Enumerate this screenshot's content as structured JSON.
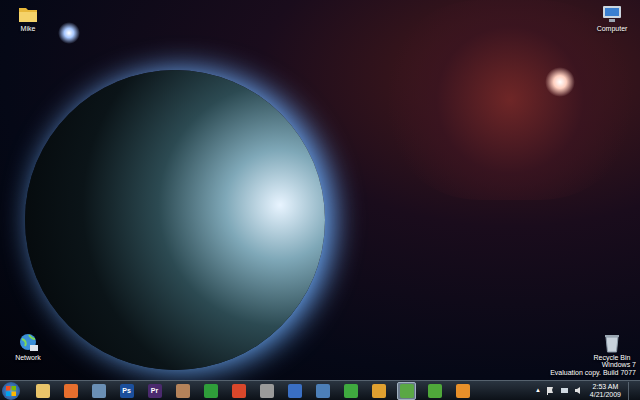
{
  "desktop_icons": [
    {
      "label": "Mike",
      "kind": "folder"
    },
    {
      "label": "Computer",
      "kind": "computer"
    },
    {
      "label": "Network",
      "kind": "network"
    },
    {
      "label": "Recycle Bin",
      "kind": "recycle-bin"
    }
  ],
  "watermark": [
    "Windows 7",
    "Evaluation copy. Build 7077"
  ],
  "taskbar": {
    "start_button": {
      "selected": false
    },
    "items": [
      {
        "label": "",
        "color": "#e9c46a",
        "active": false
      },
      {
        "label": "",
        "color": "#e76f2e",
        "active": false
      },
      {
        "label": "",
        "color": "#6a8fb5",
        "active": false
      },
      {
        "label": "Ps",
        "color": "#1b4f9c",
        "active": false
      },
      {
        "label": "Pr",
        "color": "#4b2a6e",
        "active": false
      },
      {
        "label": "",
        "color": "#b5835a",
        "active": false
      },
      {
        "label": "",
        "color": "#2f9e3a",
        "active": false
      },
      {
        "label": "",
        "color": "#d9472b",
        "active": false
      },
      {
        "label": "",
        "color": "#9a9a9a",
        "active": false
      },
      {
        "label": "",
        "color": "#3a6fc4",
        "active": false
      },
      {
        "label": "",
        "color": "#4c7fb8",
        "active": false
      },
      {
        "label": "",
        "color": "#3faa3f",
        "active": false
      },
      {
        "label": "",
        "color": "#e0a030",
        "active": false
      },
      {
        "label": "",
        "color": "#5aa845",
        "active": true
      },
      {
        "label": "",
        "color": "#4fa83a",
        "active": false
      },
      {
        "label": "",
        "color": "#e8902a",
        "active": false
      }
    ],
    "tray": {
      "overflow": "▲",
      "time": "2:53 AM",
      "date": "4/21/2009"
    }
  }
}
